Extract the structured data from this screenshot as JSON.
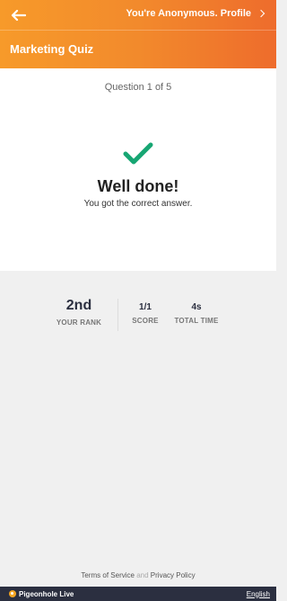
{
  "header": {
    "back_icon": "arrow-left-icon",
    "anonymous_text": "You're Anonymous. Profile",
    "quiz_title": "Marketing Quiz",
    "gradient_start": "#f79a2a",
    "gradient_end": "#ee6c2c"
  },
  "result": {
    "question_counter": "Question 1 of 5",
    "status_icon": "checkmark-icon",
    "status_color": "#17a673",
    "headline": "Well done!",
    "message": "You got the correct answer."
  },
  "stats": {
    "rank_value": "2nd",
    "rank_label": "YOUR RANK",
    "score_value": "1/1",
    "score_label": "SCORE",
    "time_value": "4s",
    "time_label": "TOTAL TIME"
  },
  "footer": {
    "terms": "Terms of Service",
    "and": "and",
    "privacy": "Privacy Policy",
    "brand": "Pigeonhole Live",
    "language": "English",
    "bar_color": "#2b2f40"
  }
}
